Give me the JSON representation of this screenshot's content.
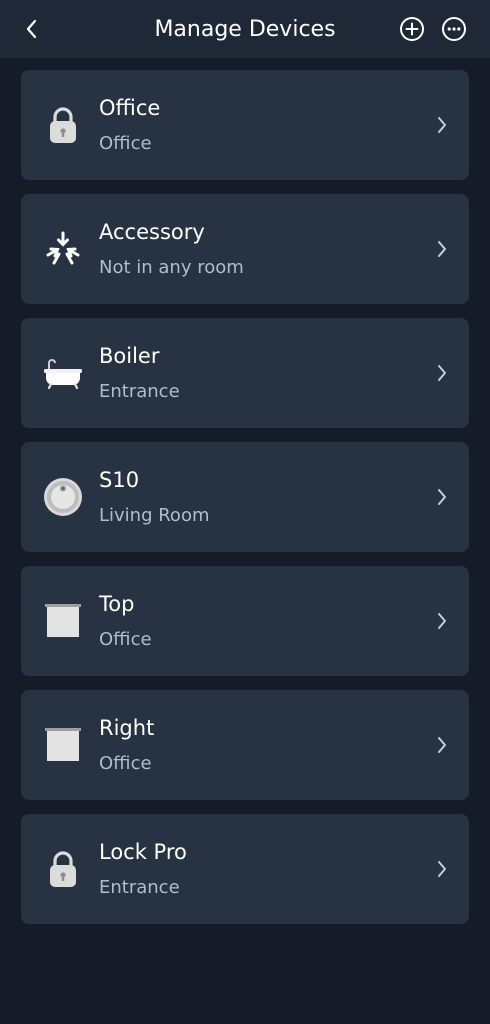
{
  "header": {
    "title": "Manage Devices",
    "back_icon": "chevron-left-icon",
    "add_icon": "plus-circle-icon",
    "more_icon": "more-horizontal-icon"
  },
  "colors": {
    "background": "#151c27",
    "header": "#1f2836",
    "card": "#273243",
    "primary_text": "#ffffff",
    "secondary_text": "#b4bcc8"
  },
  "devices": [
    {
      "name": "Office",
      "room": "Office",
      "icon": "lock-icon"
    },
    {
      "name": "Accessory",
      "room": "Not in any room",
      "icon": "accessory-icon"
    },
    {
      "name": "Boiler",
      "room": "Entrance",
      "icon": "bathtub-icon"
    },
    {
      "name": "S10",
      "room": "Living Room",
      "icon": "robot-vacuum-icon"
    },
    {
      "name": "Top",
      "room": "Office",
      "icon": "window-blind-icon"
    },
    {
      "name": "Right",
      "room": "Office",
      "icon": "window-blind-icon"
    },
    {
      "name": "Lock Pro",
      "room": "Entrance",
      "icon": "lock-icon"
    }
  ]
}
